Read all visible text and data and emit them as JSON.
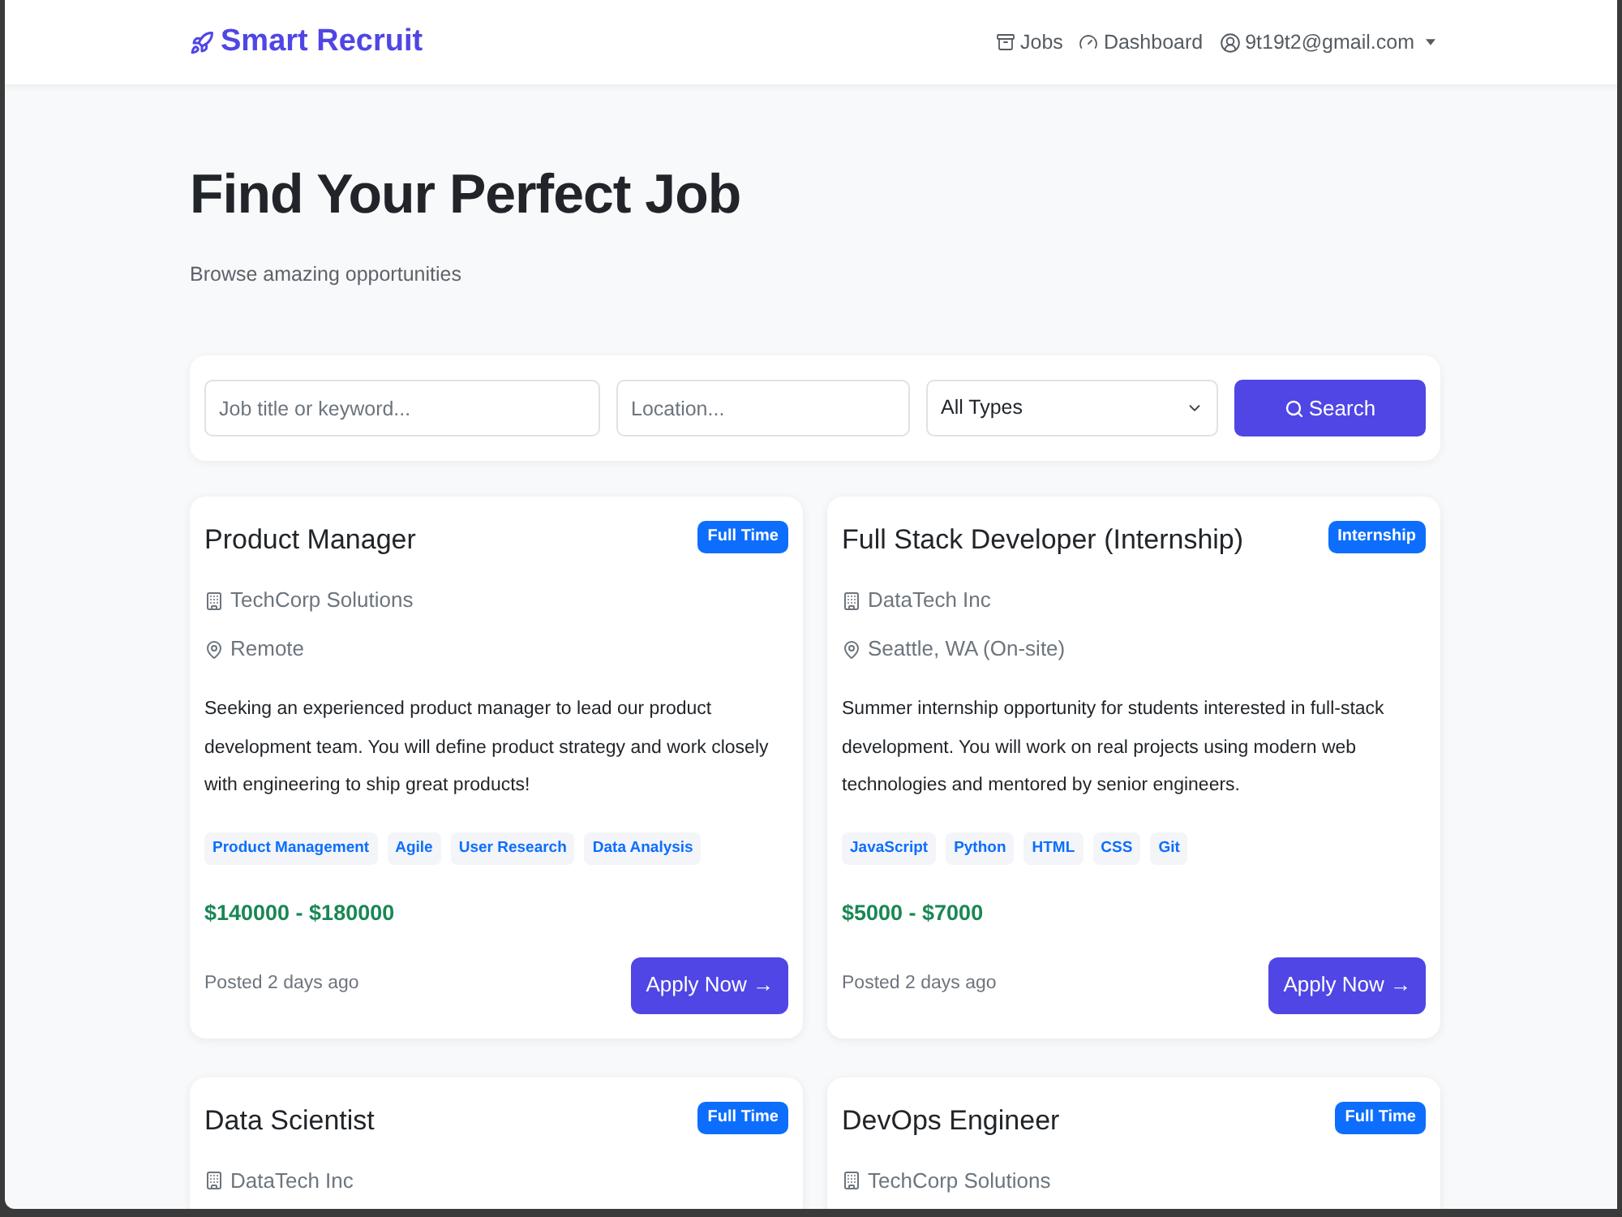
{
  "navbar": {
    "brand": "Smart Recruit",
    "jobs_link": "Jobs",
    "dashboard_link": "Dashboard",
    "user_menu": "9t19t2@gmail.com"
  },
  "hero": {
    "title": "Find Your Perfect Job",
    "subtitle": "Browse amazing opportunities"
  },
  "search": {
    "keyword": {
      "placeholder": "Job title or keyword..."
    },
    "location": {
      "placeholder": "Location..."
    },
    "type_select": {
      "value": "All Types"
    },
    "button": "Search"
  },
  "jobs": [
    {
      "title": "Product Manager",
      "type": "Full Time",
      "company": "TechCorp Solutions",
      "location": "Remote",
      "description": "Seeking an experienced product manager to lead our product development team. You will define product strategy and work closely with engineering to ship great products!",
      "skills": [
        "Product Management",
        "Agile",
        "User Research",
        "Data Analysis"
      ],
      "salary": "$140000 - $180000",
      "posted": "Posted 2 days ago",
      "apply_button": "Apply Now →"
    },
    {
      "title": "Full Stack Developer (Internship)",
      "type": "Internship",
      "company": "DataTech Inc",
      "location": "Seattle, WA (On-site)",
      "description": "Summer internship opportunity for students interested in full-stack development. You will work on real projects using modern web technologies and mentored by senior engineers.",
      "skills": [
        "JavaScript",
        "Python",
        "HTML",
        "CSS",
        "Git"
      ],
      "salary": "$5000 - $7000",
      "posted": "Posted 2 days ago",
      "apply_button": "Apply Now →"
    },
    {
      "title": "Data Scientist",
      "type": "Full Time",
      "company": "DataTech Inc"
    },
    {
      "title": "DevOps Engineer",
      "type": "Full Time",
      "company": "TechCorp Solutions"
    }
  ]
}
